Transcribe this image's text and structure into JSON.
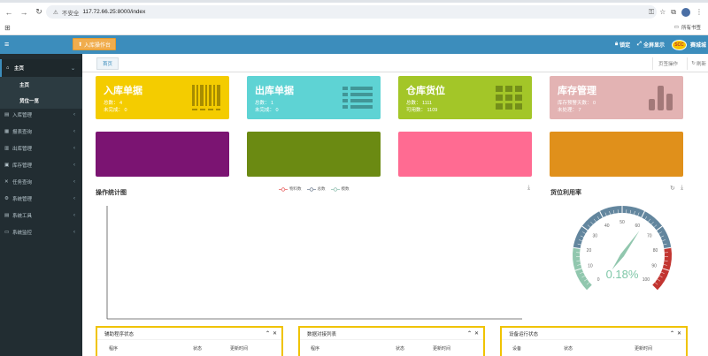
{
  "browser": {
    "address_warning": "不安全",
    "url": "117.72.66.25:8000/index",
    "bookmarks_all": "所有书签"
  },
  "header": {
    "inbound_button": "入库操作台",
    "lock_label": "锁定",
    "fullscreen_label": "全屏显示",
    "brand_logo_text": "SCC",
    "brand_name": "赛城城"
  },
  "sidebar": {
    "items": [
      {
        "label": "主页",
        "icon": "home-icon"
      },
      {
        "label": "入库管理",
        "icon": "inbox-icon"
      },
      {
        "label": "报表查询",
        "icon": "report-icon"
      },
      {
        "label": "出库管理",
        "icon": "outbox-icon"
      },
      {
        "label": "库存管理",
        "icon": "stock-icon"
      },
      {
        "label": "任务查询",
        "icon": "task-icon"
      },
      {
        "label": "系统管理",
        "icon": "gear-icon"
      },
      {
        "label": "系统工具",
        "icon": "tool-icon"
      },
      {
        "label": "系统监控",
        "icon": "monitor-icon"
      }
    ],
    "sub_items": [
      "主页",
      "货位一览"
    ]
  },
  "tabbar": {
    "home_tab": "首页",
    "page_ops": "页签操作",
    "refresh": "刷新"
  },
  "cards": [
    {
      "title": "入库单据",
      "line1": "总数： 4",
      "line2": "未完成： 0",
      "color": "#f4cc00",
      "icon": "barcode-icon"
    },
    {
      "title": "出库单据",
      "line1": "总数： 1",
      "line2": "未完成： 0",
      "color": "#5ed3d4",
      "icon": "list-icon"
    },
    {
      "title": "仓库货位",
      "line1": "总数： 1111",
      "line2": "可用数： 1109",
      "color": "#a3c628",
      "icon": "grid-icon"
    },
    {
      "title": "库存管理",
      "line1": "库存预警天数： 0",
      "line2": "未处理： 7",
      "color": "#e3b3b3",
      "icon": "bar-chart-icon"
    }
  ],
  "color_tiles": [
    "#7b1472",
    "#6b8a12",
    "#ff6b92",
    "#e0901b"
  ],
  "ops_chart": {
    "title": "操作统计图",
    "legend": [
      "物料数",
      "总数",
      "模数"
    ],
    "legend_colors": [
      "#e96a6a",
      "#7d8a9b",
      "#97c3b4"
    ]
  },
  "gauge": {
    "title": "货位利用率",
    "value": 0.18,
    "display": "0.18%",
    "ticks": [
      "0",
      "10",
      "20",
      "30",
      "40",
      "50",
      "60",
      "70",
      "80",
      "90",
      "100"
    ]
  },
  "panels": [
    {
      "title": "辅助程序状态",
      "cols": [
        "程序",
        "状态",
        "更新时间"
      ]
    },
    {
      "title": "数据对接列表",
      "cols": [
        "程序",
        "状态",
        "更新时间"
      ]
    },
    {
      "title": "设备运行状态",
      "cols": [
        "设备",
        "状态",
        "更新时间"
      ]
    }
  ]
}
